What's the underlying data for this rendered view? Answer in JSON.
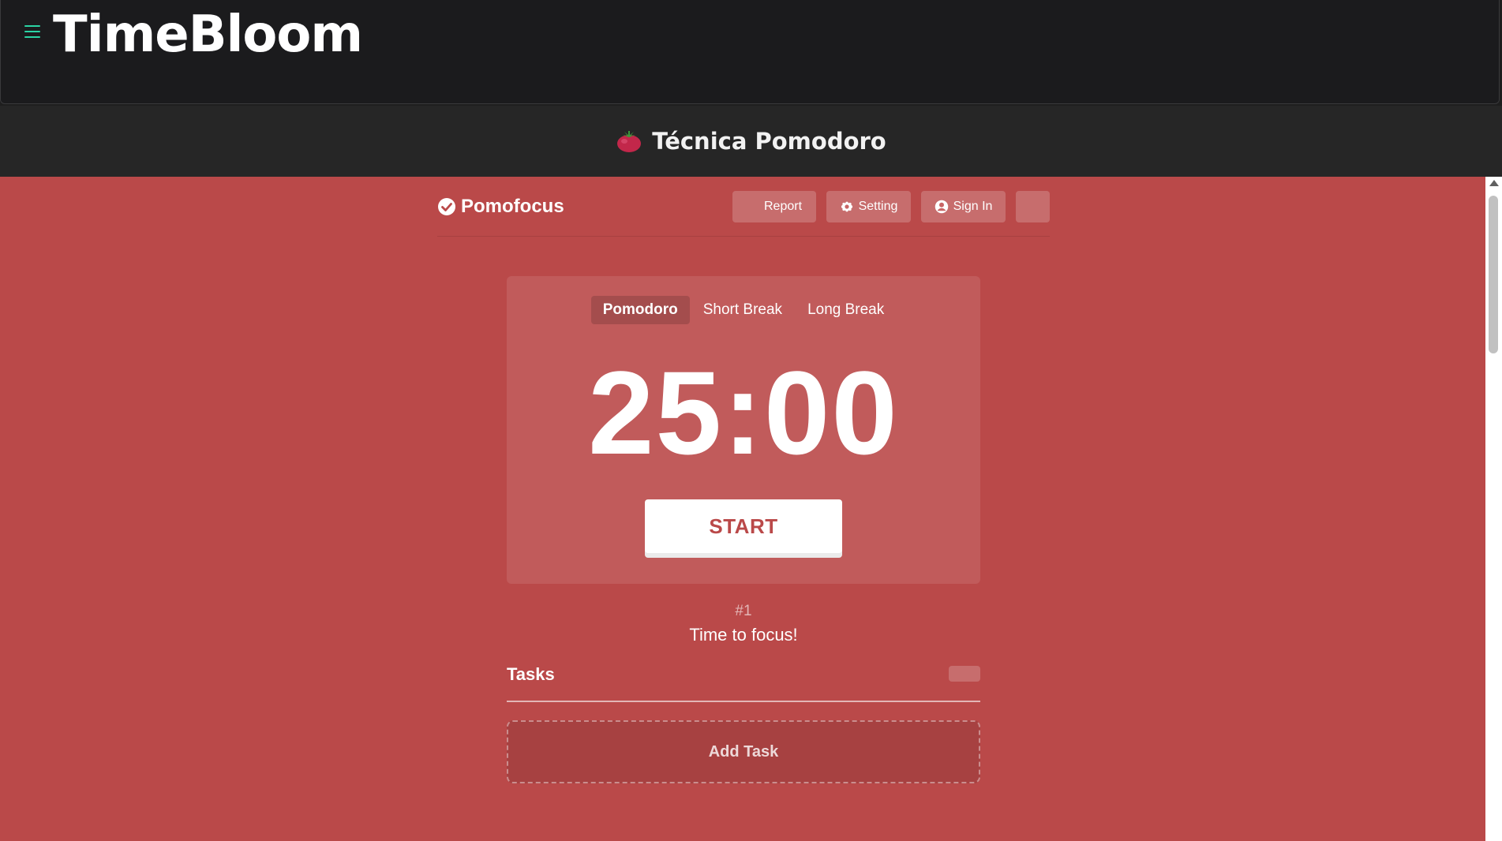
{
  "app": {
    "brand": "TimeBloom",
    "menu_icon": "hamburger-menu-icon",
    "accent_color": "#2bd4a4"
  },
  "subheader": {
    "emoji_icon": "tomato-icon",
    "title": "Técnica Pomodoro"
  },
  "pomofocus": {
    "logo_text": "Pomofocus",
    "logo_icon": "check-circle-icon",
    "background_color": "#ba4949",
    "nav": {
      "report": "Report",
      "setting": "Setting",
      "sign_in": "Sign In"
    },
    "modes": [
      "Pomodoro",
      "Short Break",
      "Long Break"
    ],
    "active_mode": "Pomodoro",
    "timer": "25:00",
    "start_label": "START",
    "session_count": "#1",
    "message": "Time to focus!",
    "tasks": {
      "title": "Tasks",
      "add_label": "Add Task"
    }
  }
}
